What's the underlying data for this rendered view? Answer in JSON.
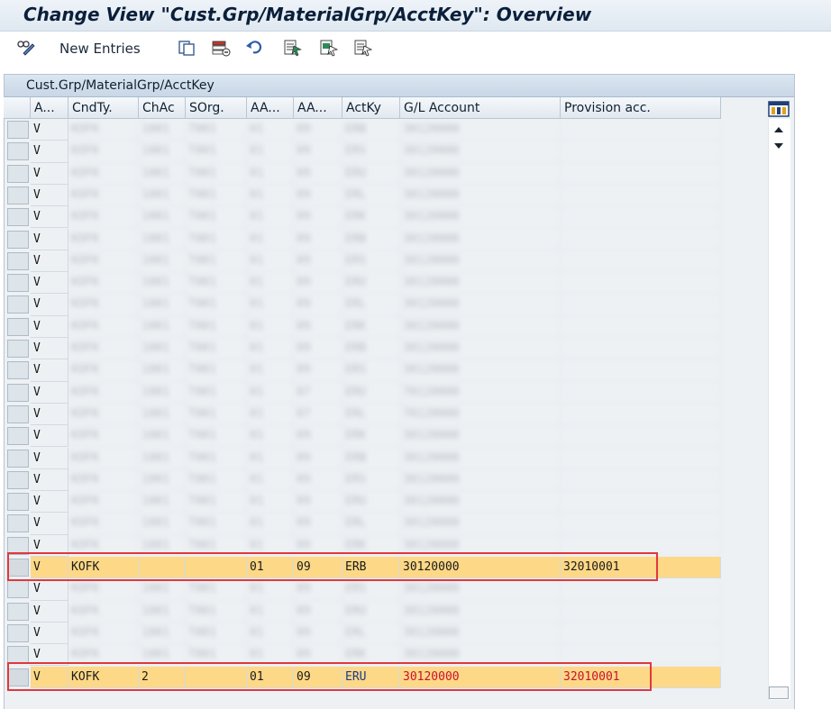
{
  "title": "Change View \"Cust.Grp/MaterialGrp/AcctKey\": Overview",
  "toolbar": {
    "new_entries_label": "New Entries",
    "icons": [
      "display-change-icon",
      "copy-icon",
      "delete-icon",
      "undo-icon",
      "select-all-icon",
      "select-block-icon",
      "deselect-all-icon"
    ]
  },
  "panel": {
    "title": "Cust.Grp/MaterialGrp/AcctKey"
  },
  "columns": [
    "A...",
    "CndTy.",
    "ChAc",
    "SOrg.",
    "AA...",
    "AA...",
    "ActKy",
    "G/L Account",
    "Provision acc."
  ],
  "rows": [
    {
      "blurred": true,
      "cells": [
        "V",
        "KOFK",
        "1001",
        "T001",
        "01",
        "09",
        "ERB",
        "30120000",
        ""
      ]
    },
    {
      "blurred": true,
      "cells": [
        "V",
        "KOFK",
        "1001",
        "T001",
        "01",
        "09",
        "ERS",
        "30120000",
        ""
      ]
    },
    {
      "blurred": true,
      "cells": [
        "V",
        "KOFK",
        "1001",
        "T001",
        "01",
        "09",
        "ERU",
        "30120000",
        ""
      ]
    },
    {
      "blurred": true,
      "cells": [
        "V",
        "KOFK",
        "1001",
        "T001",
        "01",
        "09",
        "ERL",
        "30120000",
        ""
      ]
    },
    {
      "blurred": true,
      "cells": [
        "V",
        "KOFK",
        "1001",
        "T001",
        "01",
        "09",
        "ERK",
        "30120000",
        ""
      ]
    },
    {
      "blurred": true,
      "cells": [
        "V",
        "KOFK",
        "1001",
        "T001",
        "01",
        "09",
        "ERB",
        "30120000",
        ""
      ]
    },
    {
      "blurred": true,
      "cells": [
        "V",
        "KOFK",
        "1001",
        "T001",
        "01",
        "09",
        "ERS",
        "30120000",
        ""
      ]
    },
    {
      "blurred": true,
      "cells": [
        "V",
        "KOFK",
        "1001",
        "T001",
        "01",
        "09",
        "ERU",
        "30120000",
        ""
      ]
    },
    {
      "blurred": true,
      "cells": [
        "V",
        "KOFK",
        "1001",
        "T001",
        "01",
        "09",
        "ERL",
        "30120000",
        ""
      ]
    },
    {
      "blurred": true,
      "cells": [
        "V",
        "KOFK",
        "1001",
        "T001",
        "01",
        "09",
        "ERK",
        "30120000",
        ""
      ]
    },
    {
      "blurred": true,
      "cells": [
        "V",
        "KOFK",
        "1001",
        "T001",
        "01",
        "09",
        "ERB",
        "30120000",
        ""
      ]
    },
    {
      "blurred": true,
      "cells": [
        "V",
        "KOFK",
        "1001",
        "T001",
        "01",
        "09",
        "ERS",
        "30120000",
        ""
      ]
    },
    {
      "blurred": true,
      "cells": [
        "V",
        "KOFK",
        "1001",
        "T001",
        "01",
        "07",
        "ERU",
        "70120000",
        ""
      ]
    },
    {
      "blurred": true,
      "cells": [
        "V",
        "KOFK",
        "1001",
        "T001",
        "01",
        "07",
        "ERL",
        "70120000",
        ""
      ]
    },
    {
      "blurred": true,
      "cells": [
        "V",
        "KOFK",
        "1001",
        "T001",
        "01",
        "09",
        "ERK",
        "30120000",
        ""
      ]
    },
    {
      "blurred": true,
      "cells": [
        "V",
        "KOFK",
        "1001",
        "T001",
        "01",
        "09",
        "ERB",
        "30120000",
        ""
      ]
    },
    {
      "blurred": true,
      "cells": [
        "V",
        "KOFK",
        "1001",
        "T001",
        "01",
        "09",
        "ERS",
        "30120000",
        ""
      ]
    },
    {
      "blurred": true,
      "cells": [
        "V",
        "KOFK",
        "1001",
        "T001",
        "01",
        "09",
        "ERU",
        "30120000",
        ""
      ]
    },
    {
      "blurred": true,
      "cells": [
        "V",
        "KOFK",
        "1001",
        "T001",
        "01",
        "09",
        "ERL",
        "30120000",
        ""
      ]
    },
    {
      "blurred": true,
      "cells": [
        "V",
        "KOFK",
        "1001",
        "T001",
        "01",
        "09",
        "ERK",
        "30120000",
        ""
      ]
    },
    {
      "blurred": false,
      "highlighted": true,
      "text_color": "normal",
      "cells": [
        "V",
        "KOFK",
        "",
        "",
        "01",
        "09",
        "ERB",
        "30120000",
        "32010001"
      ]
    },
    {
      "blurred": true,
      "cells": [
        "V",
        "KOFK",
        "1001",
        "T001",
        "01",
        "09",
        "ERS",
        "30120000",
        ""
      ]
    },
    {
      "blurred": true,
      "cells": [
        "V",
        "KOFK",
        "1001",
        "T001",
        "01",
        "09",
        "ERU",
        "30120000",
        ""
      ]
    },
    {
      "blurred": true,
      "cells": [
        "V",
        "KOFK",
        "1001",
        "T001",
        "01",
        "09",
        "ERL",
        "30120000",
        ""
      ]
    },
    {
      "blurred": true,
      "cells": [
        "V",
        "KOFK",
        "1001",
        "T001",
        "01",
        "09",
        "ERK",
        "30120000",
        ""
      ]
    },
    {
      "blurred": false,
      "highlighted": true,
      "text_color": "mixed",
      "cells": [
        "V",
        "KOFK",
        "2",
        "",
        "01",
        "09",
        "ERU",
        "30120000",
        "32010001"
      ]
    }
  ],
  "colors": {
    "highlight": "#fdd886",
    "red_box": "#e0383c",
    "header_bg": "#dbe6f1"
  }
}
